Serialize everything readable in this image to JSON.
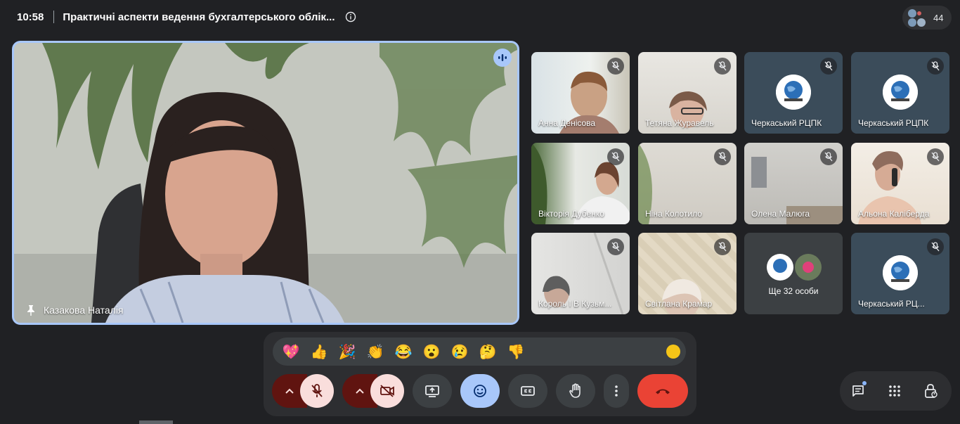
{
  "header": {
    "time": "10:58",
    "title": "Практичні аспекти ведення бухгалтерського облік...",
    "participants_count": "44"
  },
  "main_speaker": {
    "name": "Казакова Наталія",
    "icons": [
      "pin-icon",
      "speaking-indicator-icon"
    ]
  },
  "tiles": [
    {
      "name": "Анна Денісова",
      "muted": true,
      "type": "video"
    },
    {
      "name": "Тетяна Журавель",
      "muted": true,
      "type": "video"
    },
    {
      "name": "Черкаський РЦПК",
      "muted": true,
      "type": "avatar"
    },
    {
      "name": "Черкаський РЦПК",
      "muted": true,
      "type": "avatar"
    },
    {
      "name": "Вікторія Дубенко",
      "muted": true,
      "type": "video"
    },
    {
      "name": "Ніна Колотило",
      "muted": true,
      "type": "video"
    },
    {
      "name": "Олена Малюга",
      "muted": true,
      "type": "video"
    },
    {
      "name": "Альона Каліберда",
      "muted": true,
      "type": "video"
    },
    {
      "name": "Король І В Кузьм...",
      "muted": true,
      "type": "video"
    },
    {
      "name": "Світлана Крамар",
      "muted": true,
      "type": "video"
    },
    {
      "name": "Ще 32 особи",
      "muted": false,
      "type": "more"
    },
    {
      "name": "Черкаський РЦ...",
      "muted": true,
      "type": "avatar"
    }
  ],
  "reactions": [
    "💖",
    "👍",
    "🎉",
    "👏",
    "😂",
    "😮",
    "😢",
    "🤔",
    "👎"
  ],
  "controls": [
    "mic-options",
    "mic-off",
    "camera-options",
    "camera-off",
    "present-screen",
    "reactions",
    "captions",
    "raise-hand",
    "more-options",
    "leave-call"
  ],
  "side_controls": [
    "chat",
    "activities",
    "host-controls"
  ],
  "colors": {
    "background": "#202124",
    "active_border": "#a8c7fa",
    "leave": "#ea4335",
    "muted_bg": "#f9dedc",
    "muted_dark": "#601410"
  }
}
